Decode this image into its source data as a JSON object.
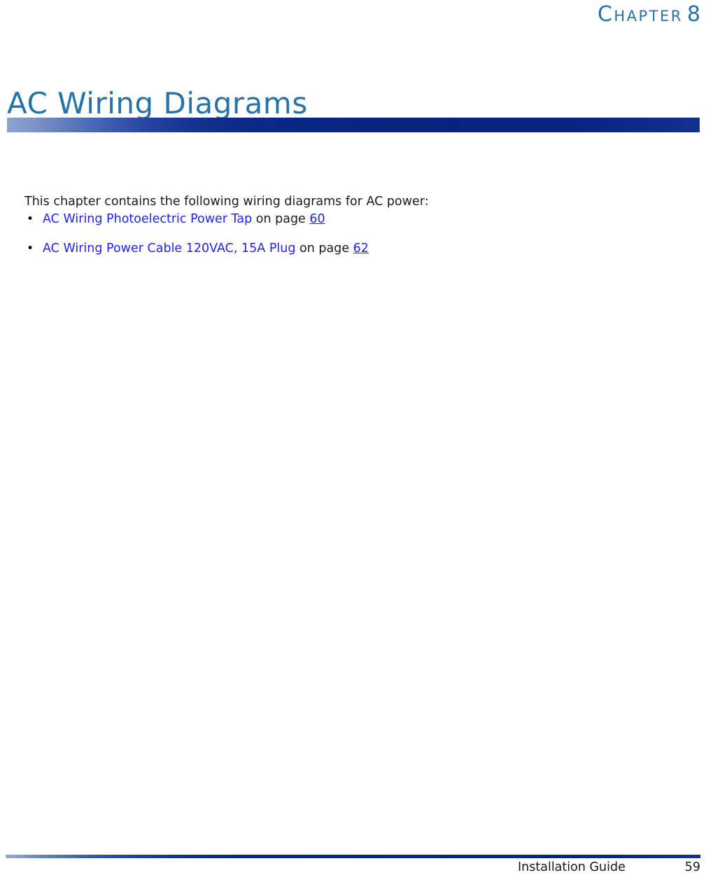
{
  "header": {
    "chapter_label": "Chapter",
    "chapter_number": "8",
    "title": "AC Wiring Diagrams",
    "rule_gradient_start": "#8ea4ce",
    "rule_gradient_end": "#09237f"
  },
  "body": {
    "intro_paragraph": "This chapter contains the following wiring diagrams for AC power:",
    "bullet_glyph": "•",
    "link_color": "#2222ee",
    "cross_references": [
      {
        "link_text": "AC Wiring Photoelectric Power Tap",
        "separator": " on page ",
        "page": "60"
      },
      {
        "link_text": "AC Wiring Power Cable 120VAC, 15A Plug",
        "separator": " on page ",
        "page": "62"
      }
    ]
  },
  "footer": {
    "document_title": "Installation Guide",
    "page_number": "59",
    "rule_gradient_start": "#96a9d0",
    "rule_gradient_end": "#09237f"
  },
  "theme": {
    "heading_blue": "#2573a8",
    "navy": "#09237f",
    "text_black": "#1a1a1a"
  }
}
